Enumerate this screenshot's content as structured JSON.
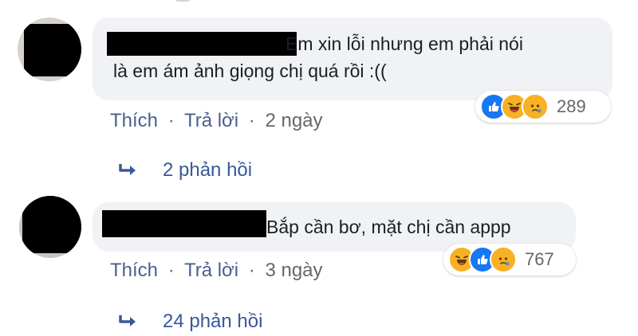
{
  "comments": [
    {
      "text": "Em xin lỗi nhưng em phải nói\nlà em ám ảnh giọng chị quá rồi :((",
      "actions": {
        "like": "Thích",
        "separator": "·",
        "reply": "Trả lời",
        "time": "2 ngày"
      },
      "reactions": {
        "icons": [
          "like-icon",
          "haha-icon",
          "sad-icon"
        ],
        "count": "289"
      },
      "replies": "2 phản hồi"
    },
    {
      "text": "Bắp cần bơ, mặt chị cần appp",
      "actions": {
        "like": "Thích",
        "separator": "·",
        "reply": "Trả lời",
        "time": "3 ngày"
      },
      "reactions": {
        "icons": [
          "haha-icon",
          "like-icon",
          "sad-icon"
        ],
        "count": "767"
      },
      "replies": "24 phản hồi"
    }
  ],
  "colors": {
    "bubble": "#f0f2f5",
    "link": "#4b5f8d",
    "reply_link": "#385898",
    "like_blue": "#1877f2",
    "emoji_yellow": "#f7b125",
    "muted": "#65676b"
  }
}
